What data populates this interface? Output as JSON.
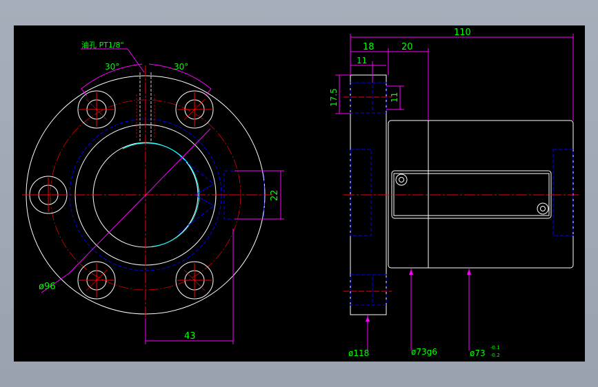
{
  "colors": {
    "background": "#000000",
    "frame": "#9da5b3",
    "outline": "#ffffff",
    "dimension": "#00ff00",
    "leader": "#ff00ff",
    "centerline": "#ff0000",
    "hidden": "#0000ff",
    "highlight": "#00ffff"
  },
  "front_view": {
    "oil_hole_label": "油孔 PT1/8\"",
    "angle_left": "30°",
    "angle_right": "30°",
    "dim_side": "22",
    "dim_bottom": "43",
    "dia_pcd": "ø96"
  },
  "side_view": {
    "dim_total": "110",
    "dim_18": "18",
    "dim_20": "20",
    "dim_11_top": "11",
    "dim_17_5": "17.5",
    "dim_11_side": "11",
    "dia_118": "ø118",
    "dia_73g6": "ø73g6",
    "dia_73_base": "ø73",
    "tol_upper": "-0.1",
    "tol_lower": "-0.2"
  }
}
